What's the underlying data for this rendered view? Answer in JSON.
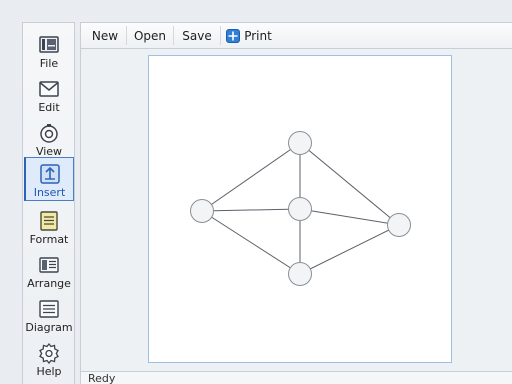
{
  "sidebar": {
    "items": [
      {
        "label": "File",
        "icon": "file-icon",
        "active": false
      },
      {
        "label": "Edit",
        "icon": "edit-icon",
        "active": false
      },
      {
        "label": "View",
        "icon": "view-icon",
        "active": false
      },
      {
        "label": "Insert",
        "icon": "insert-icon",
        "active": true
      },
      {
        "label": "Format",
        "icon": "format-icon",
        "active": false
      },
      {
        "label": "Arrange",
        "icon": "arrange-icon",
        "active": false
      },
      {
        "label": "Diagram",
        "icon": "diagram-icon",
        "active": false
      },
      {
        "label": "Help",
        "icon": "help-icon",
        "active": false
      }
    ]
  },
  "toolbar": {
    "new_label": "New",
    "open_label": "Open",
    "save_label": "Save",
    "print_label": "Print"
  },
  "status": {
    "text": "Redy"
  },
  "colors": {
    "accent": "#2b63b5",
    "active_bg": "#dfeafa",
    "node_fill": "#f3f4f6",
    "node_stroke": "#8a8f96",
    "edge": "#5b6068"
  },
  "diagram": {
    "nodes": [
      "left",
      "top",
      "center",
      "right",
      "bottom"
    ],
    "edges": [
      [
        "left",
        "top"
      ],
      [
        "left",
        "center"
      ],
      [
        "left",
        "bottom"
      ],
      [
        "top",
        "center"
      ],
      [
        "top",
        "right"
      ],
      [
        "center",
        "right"
      ],
      [
        "center",
        "bottom"
      ],
      [
        "bottom",
        "right"
      ]
    ]
  }
}
